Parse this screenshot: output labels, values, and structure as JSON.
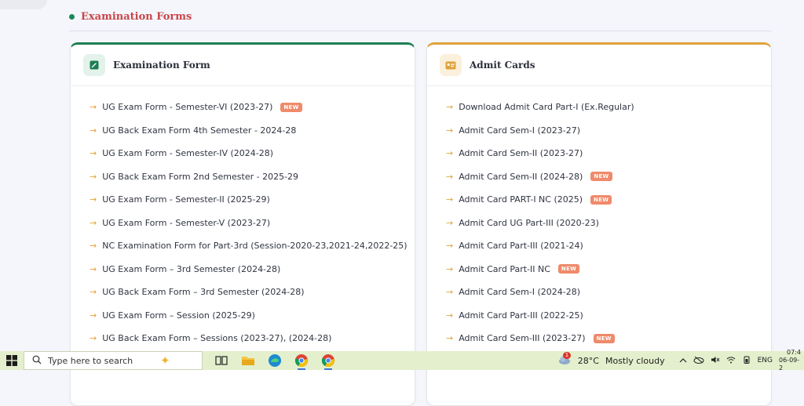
{
  "section": {
    "title": "Examination Forms"
  },
  "exam_card": {
    "title": "Examination Form",
    "icon": "pencil-square-icon",
    "accent": "#1d7e52",
    "items": [
      {
        "label": "UG Exam Form - Semester-VI (2023-27)",
        "badge": "NEW"
      },
      {
        "label": "UG Back Exam Form 4th Semester - 2024-28",
        "badge": ""
      },
      {
        "label": "UG Exam Form - Semester-IV (2024-28)",
        "badge": ""
      },
      {
        "label": "UG Back Exam Form 2nd Semester - 2025-29",
        "badge": ""
      },
      {
        "label": "UG Exam Form - Semester-II (2025-29)",
        "badge": ""
      },
      {
        "label": "UG Exam Form - Semester-V (2023-27)",
        "badge": ""
      },
      {
        "label": "NC Examination Form for Part-3rd (Session-2020-23,2021-24,2022-25)",
        "badge": ""
      },
      {
        "label": "UG Exam Form – 3rd Semester (2024-28)",
        "badge": ""
      },
      {
        "label": "UG Back Exam Form – 3rd Semester (2024-28)",
        "badge": ""
      },
      {
        "label": "UG Exam Form – Session (2025-29)",
        "badge": ""
      },
      {
        "label": "UG Back Exam Form – Sessions (2023-27), (2024-28)",
        "badge": ""
      }
    ]
  },
  "admit_card": {
    "title": "Admit Cards",
    "icon": "id-card-icon",
    "accent": "#e0a23a",
    "items": [
      {
        "label": "Download Admit Card Part-I (Ex.Regular)",
        "badge": ""
      },
      {
        "label": "Admit Card Sem-I (2023-27)",
        "badge": ""
      },
      {
        "label": "Admit Card Sem-II (2023-27)",
        "badge": ""
      },
      {
        "label": "Admit Card Sem-II (2024-28)",
        "badge": "NEW"
      },
      {
        "label": "Admit Card PART-I NC (2025)",
        "badge": "NEW"
      },
      {
        "label": "Admit Card UG Part-III (2020-23)",
        "badge": ""
      },
      {
        "label": "Admit Card Part-III (2021-24)",
        "badge": ""
      },
      {
        "label": "Admit Card Part-II NC",
        "badge": "NEW"
      },
      {
        "label": "Admit Card Sem-I (2024-28)",
        "badge": ""
      },
      {
        "label": "Admit Card Part-III (2022-25)",
        "badge": ""
      },
      {
        "label": "Admit Card Sem-III (2023-27)",
        "badge": "NEW"
      }
    ]
  },
  "taskbar": {
    "search_placeholder": "Type here to search",
    "weather_badge": "1",
    "temperature": "28°C",
    "weather": "Mostly cloudy",
    "language": "ENG",
    "time": "07:4",
    "date": "06-09-2"
  }
}
